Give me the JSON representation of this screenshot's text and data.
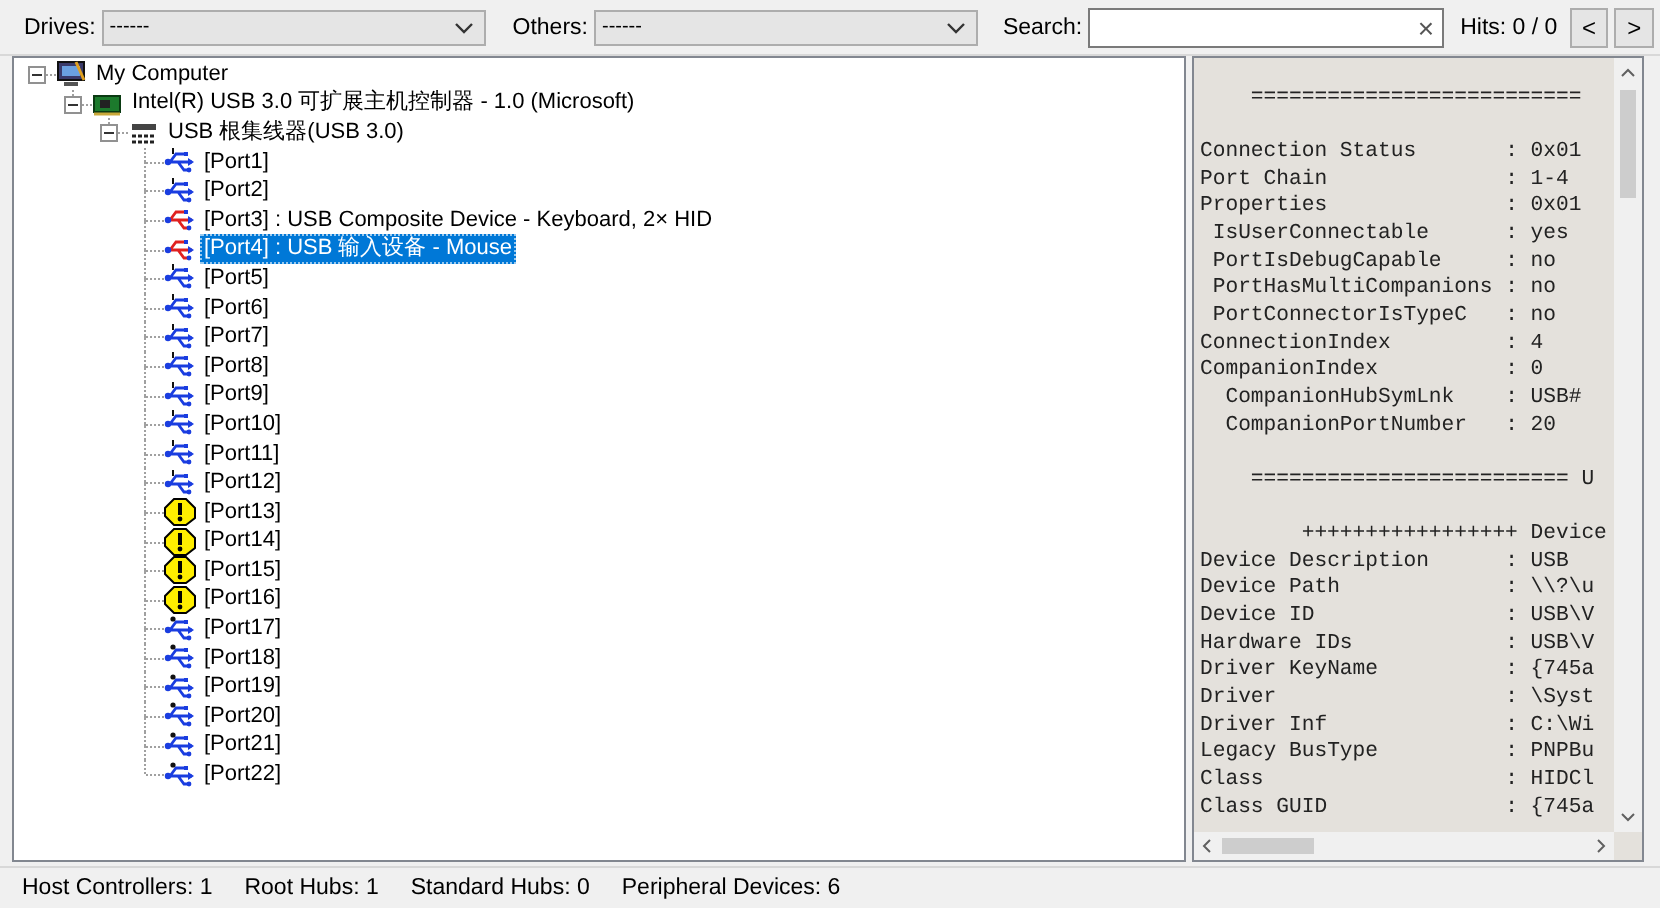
{
  "toolbar": {
    "drives_label": "Drives:",
    "drives_value": "------",
    "others_label": "Others:",
    "others_value": "------",
    "search_label": "Search:",
    "clear_button": "×",
    "hits": "Hits: 0 / 0",
    "prev_button": "<",
    "next_button": ">"
  },
  "device_tree": [
    {
      "kind": "computer",
      "label": "My Computer",
      "expanded": true,
      "selected": false,
      "children": [
        {
          "kind": "controller",
          "label": "Intel(R) USB 3.0 可扩展主机控制器 - 1.0 (Microsoft)",
          "expanded": true,
          "selected": false,
          "children": [
            {
              "kind": "root_hub",
              "label": "USB 根集线器(USB 3.0)",
              "expanded": true,
              "selected": false,
              "children": [
                {
                  "kind": "hub_port",
                  "label": "[Port1]",
                  "selected": false
                },
                {
                  "kind": "hub_port",
                  "label": "[Port2]",
                  "selected": false
                },
                {
                  "kind": "device_port",
                  "label": "[Port3] : USB Composite Device - Keyboard, 2× HID",
                  "selected": false
                },
                {
                  "kind": "device_port",
                  "label": "[Port4] : USB 输入设备 - Mouse",
                  "selected": true
                },
                {
                  "kind": "hub_port",
                  "label": "[Port5]",
                  "selected": false
                },
                {
                  "kind": "hub_port",
                  "label": "[Port6]",
                  "selected": false
                },
                {
                  "kind": "hub_port",
                  "label": "[Port7]",
                  "selected": false
                },
                {
                  "kind": "hub_port",
                  "label": "[Port8]",
                  "selected": false
                },
                {
                  "kind": "hub_port",
                  "label": "[Port9]",
                  "selected": false
                },
                {
                  "kind": "hub_port",
                  "label": "[Port10]",
                  "selected": false
                },
                {
                  "kind": "hub_port",
                  "label": "[Port11]",
                  "selected": false
                },
                {
                  "kind": "hub_port",
                  "label": "[Port12]",
                  "selected": false
                },
                {
                  "kind": "warning_port",
                  "label": "[Port13]",
                  "selected": false
                },
                {
                  "kind": "warning_port",
                  "label": "[Port14]",
                  "selected": false
                },
                {
                  "kind": "warning_port",
                  "label": "[Port15]",
                  "selected": false
                },
                {
                  "kind": "warning_port",
                  "label": "[Port16]",
                  "selected": false
                },
                {
                  "kind": "superspeed_port",
                  "label": "[Port17]",
                  "selected": false
                },
                {
                  "kind": "superspeed_port",
                  "label": "[Port18]",
                  "selected": false
                },
                {
                  "kind": "superspeed_port",
                  "label": "[Port19]",
                  "selected": false
                },
                {
                  "kind": "superspeed_port",
                  "label": "[Port20]",
                  "selected": false
                },
                {
                  "kind": "superspeed_port",
                  "label": "[Port21]",
                  "selected": false
                },
                {
                  "kind": "superspeed_port",
                  "label": "[Port22]",
                  "selected": false
                }
              ]
            }
          ]
        }
      ]
    }
  ],
  "details": [
    {
      "kind": "rule",
      "text": "=========================="
    },
    {
      "kind": "field",
      "text": "Connection Status       : 0x01"
    },
    {
      "kind": "field",
      "text": "Port Chain              : 1-4"
    },
    {
      "kind": "field",
      "text": "Properties              : 0x01"
    },
    {
      "kind": "field",
      "text": " IsUserConnectable      : yes"
    },
    {
      "kind": "field",
      "text": " PortIsDebugCapable     : no"
    },
    {
      "kind": "field",
      "text": " PortHasMultiCompanions : no"
    },
    {
      "kind": "field",
      "text": " PortConnectorIsTypeC   : no"
    },
    {
      "kind": "field",
      "text": "ConnectionIndex         : 4"
    },
    {
      "kind": "field",
      "text": "CompanionIndex          : 0"
    },
    {
      "kind": "field",
      "text": "  CompanionHubSymLnk    : USB#"
    },
    {
      "kind": "field",
      "text": "  CompanionPortNumber   : 20"
    },
    {
      "kind": "rule",
      "text": "========================= U"
    },
    {
      "kind": "banner",
      "text": "+++++++++++++++++ Device"
    },
    {
      "kind": "field",
      "text": "Device Description      : USB"
    },
    {
      "kind": "field",
      "text": "Device Path             : \\\\?\\u"
    },
    {
      "kind": "field",
      "text": "Device ID               : USB\\V"
    },
    {
      "kind": "field",
      "text": "Hardware IDs            : USB\\V"
    },
    {
      "kind": "field",
      "text": "Driver KeyName          : {745a"
    },
    {
      "kind": "field",
      "text": "Driver                  : \\Syst"
    },
    {
      "kind": "field",
      "text": "Driver Inf              : C:\\Wi"
    },
    {
      "kind": "field",
      "text": "Legacy BusType          : PNPBu"
    },
    {
      "kind": "field",
      "text": "Class                   : HIDCl"
    },
    {
      "kind": "field",
      "text": "Class GUID              : {745a"
    }
  ],
  "status_bar": [
    "Host Controllers: 1",
    "Root Hubs: 1",
    "Standard Hubs: 0",
    "Peripheral Devices: 6"
  ]
}
